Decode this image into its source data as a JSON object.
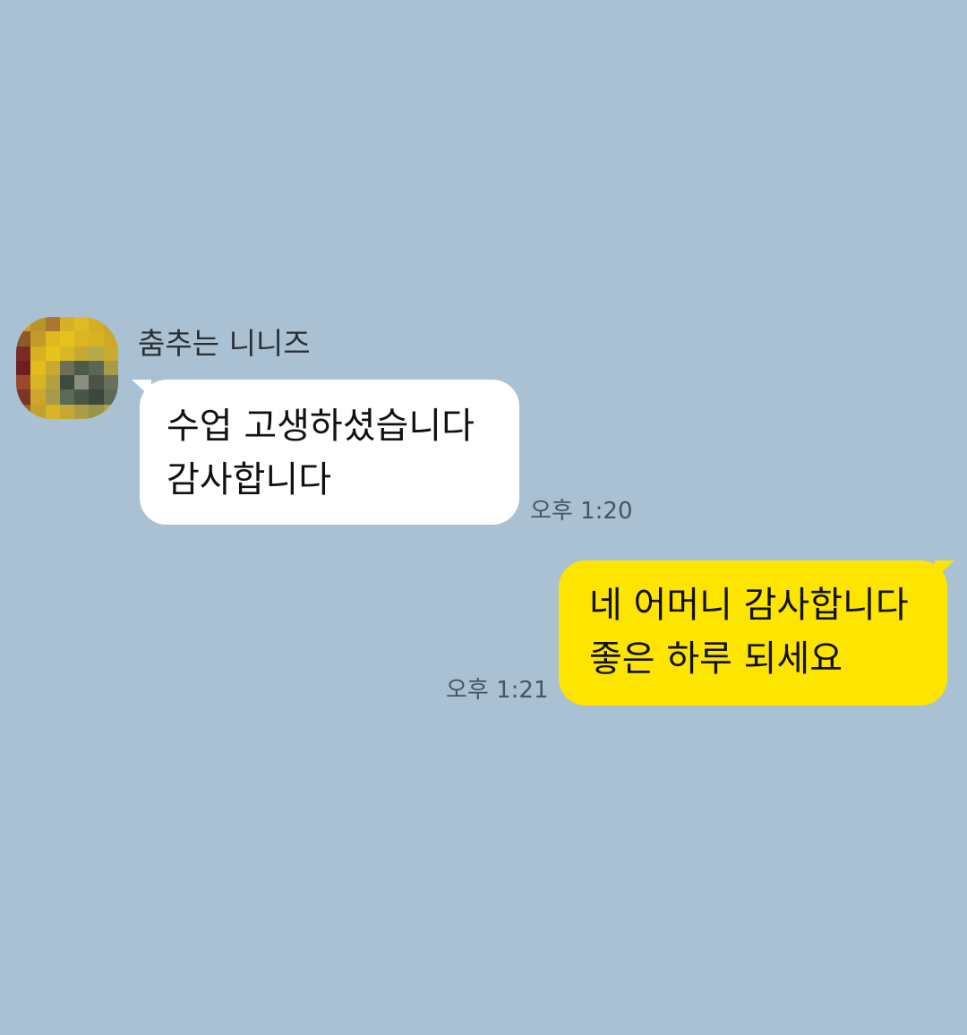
{
  "chat": {
    "background_color": "#a9c1d3",
    "messages": [
      {
        "direction": "incoming",
        "sender": "춤추는 니니즈",
        "lines": [
          "수업 고생하셨습니다",
          "감사합니다"
        ],
        "time": "오후 1:20",
        "bubble_color": "#ffffff",
        "avatar_icon": "pixelated-avatar-icon"
      },
      {
        "direction": "outgoing",
        "lines": [
          "네 어머니 감사합니다",
          "좋은 하루 되세요"
        ],
        "time": "오후 1:21",
        "bubble_color": "#fee500"
      }
    ]
  }
}
